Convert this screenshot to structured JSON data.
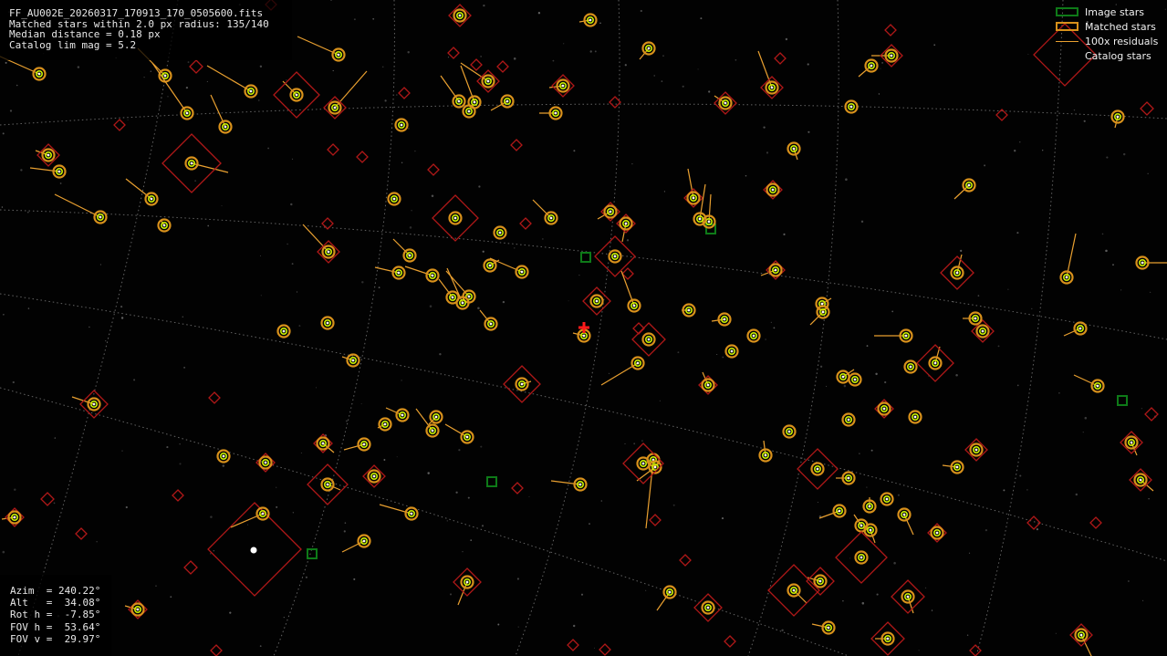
{
  "info": {
    "filename": "FF_AU002E_20260317_170913_170_0505600.fits",
    "matched": "Matched stars within 2.0 px radius: 135/140",
    "median": "Median distance = 0.18 px",
    "limmag": "Catalog lim mag = 5.2"
  },
  "pointing": {
    "azim": "Azim  = 240.22°",
    "alt": "Alt   =  34.08°",
    "rot": "Rot h =  -7.85°",
    "fovh": "FOV h =  53.64°",
    "fovv": "FOV v =  29.97°"
  },
  "legend": {
    "image_stars": "Image stars",
    "matched_stars": "Matched stars",
    "residuals": "100x residuals",
    "catalog_stars": "Catalog stars"
  },
  "colors": {
    "image_star": "#0e7a18",
    "matched_ring": "#d8911b",
    "residual_line": "#e9a030",
    "catalog_star": "#b01818",
    "star_core": "#c8f000",
    "grid": "#7a7a7a",
    "pointing_marker": "#ff1a1a"
  }
}
